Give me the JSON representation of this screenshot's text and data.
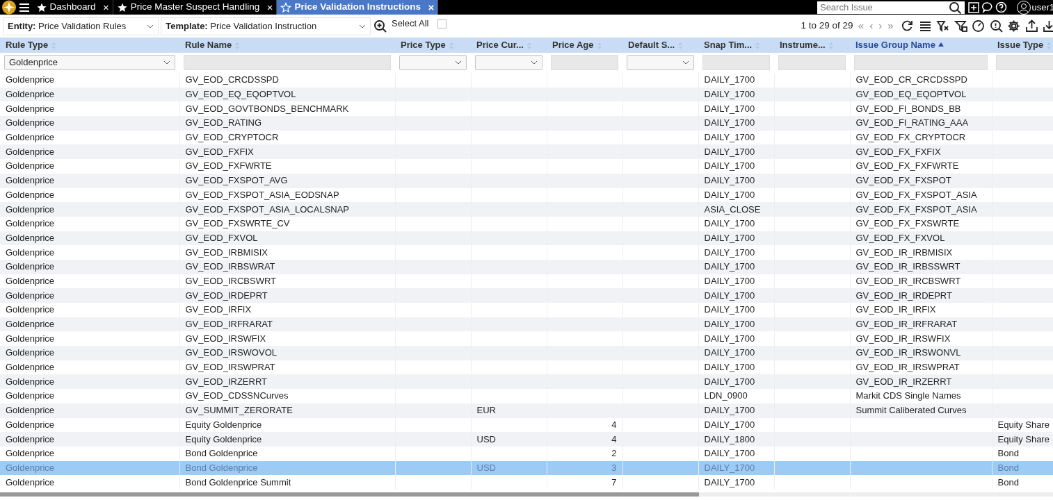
{
  "top_bar": {
    "tabs": [
      {
        "label": "Dashboard",
        "close": "×",
        "selected": false
      },
      {
        "label": "Price Master Suspect Handling",
        "close": "×",
        "selected": false
      },
      {
        "label": "Price Validation Instructions",
        "close": "×",
        "selected": true
      }
    ],
    "search": {
      "placeholder": "Search Issue"
    },
    "user": "user1"
  },
  "toolbar": {
    "entity": {
      "label": "Entity:",
      "value": "Price Validation Rules"
    },
    "template": {
      "label": "Template:",
      "value": "Price Validation Instruction"
    },
    "select_all": {
      "label": "Select All",
      "checked": false
    },
    "paging": {
      "summary": "1 to 29 of 29",
      "buttons": [
        {
          "label": "«",
          "disabled": true
        },
        {
          "label": "‹",
          "disabled": true
        },
        {
          "label": "›",
          "disabled": true
        },
        {
          "label": "»",
          "disabled": true
        }
      ]
    }
  },
  "grid": {
    "columns": [
      {
        "label": "Rule Type",
        "dropdown_filter": true,
        "filter_value": "Goldenprice",
        "sorted_ascending": false
      },
      {
        "label": "Rule Name",
        "dropdown_filter": false,
        "sorted_ascending": false
      },
      {
        "label": "Price Type",
        "dropdown_filter": true,
        "sorted_ascending": false
      },
      {
        "label": "Price Cur...",
        "dropdown_filter": true,
        "sorted_ascending": false
      },
      {
        "label": "Price Age",
        "dropdown_filter": false,
        "sorted_ascending": false
      },
      {
        "label": "Default S...",
        "dropdown_filter": true,
        "sorted_ascending": false
      },
      {
        "label": "Snap Tim...",
        "dropdown_filter": false,
        "sorted_ascending": false
      },
      {
        "label": "Instrume...",
        "dropdown_filter": false,
        "sorted_ascending": false
      },
      {
        "label": "Issue Group Name",
        "dropdown_filter": false,
        "sorted_ascending": true
      },
      {
        "label": "Issue Type",
        "dropdown_filter": false,
        "sorted_ascending": false
      }
    ],
    "rows": [
      {
        "selected": false,
        "rule_type": "Goldenprice",
        "rule_name": "GV_EOD_CRCDSSPD",
        "snap_time": "DAILY_1700",
        "issue_group_name": "GV_EOD_CR_CRCDSSPD"
      },
      {
        "selected": false,
        "rule_type": "Goldenprice",
        "rule_name": "GV_EOD_EQ_EQOPTVOL",
        "snap_time": "DAILY_1700",
        "issue_group_name": "GV_EOD_EQ_EQOPTVOL"
      },
      {
        "selected": false,
        "rule_type": "Goldenprice",
        "rule_name": "GV_EOD_GOVTBONDS_BENCHMARK",
        "snap_time": "DAILY_1700",
        "issue_group_name": "GV_EOD_FI_BONDS_BB"
      },
      {
        "selected": false,
        "rule_type": "Goldenprice",
        "rule_name": "GV_EOD_RATING",
        "snap_time": "DAILY_1700",
        "issue_group_name": "GV_EOD_FI_RATING_AAA"
      },
      {
        "selected": false,
        "rule_type": "Goldenprice",
        "rule_name": "GV_EOD_CRYPTOCR",
        "snap_time": "DAILY_1700",
        "issue_group_name": "GV_EOD_FX_CRYPTOCR"
      },
      {
        "selected": false,
        "rule_type": "Goldenprice",
        "rule_name": "GV_EOD_FXFIX",
        "snap_time": "DAILY_1700",
        "issue_group_name": "GV_EOD_FX_FXFIX"
      },
      {
        "selected": false,
        "rule_type": "Goldenprice",
        "rule_name": "GV_EOD_FXFWRTE",
        "snap_time": "DAILY_1700",
        "issue_group_name": "GV_EOD_FX_FXFWRTE"
      },
      {
        "selected": false,
        "rule_type": "Goldenprice",
        "rule_name": "GV_EOD_FXSPOT_AVG",
        "snap_time": "DAILY_1700",
        "issue_group_name": "GV_EOD_FX_FXSPOT"
      },
      {
        "selected": false,
        "rule_type": "Goldenprice",
        "rule_name": "GV_EOD_FXSPOT_ASIA_EODSNAP",
        "snap_time": "DAILY_1700",
        "issue_group_name": "GV_EOD_FX_FXSPOT_ASIA"
      },
      {
        "selected": false,
        "rule_type": "Goldenprice",
        "rule_name": "GV_EOD_FXSPOT_ASIA_LOCALSNAP",
        "snap_time": "ASIA_CLOSE",
        "issue_group_name": "GV_EOD_FX_FXSPOT_ASIA"
      },
      {
        "selected": false,
        "rule_type": "Goldenprice",
        "rule_name": "GV_EOD_FXSWRTE_CV",
        "snap_time": "DAILY_1700",
        "issue_group_name": "GV_EOD_FX_FXSWRTE"
      },
      {
        "selected": false,
        "rule_type": "Goldenprice",
        "rule_name": "GV_EOD_FXVOL",
        "snap_time": "DAILY_1700",
        "issue_group_name": "GV_EOD_FX_FXVOL"
      },
      {
        "selected": false,
        "rule_type": "Goldenprice",
        "rule_name": "GV_EOD_IRBMISIX",
        "snap_time": "DAILY_1700",
        "issue_group_name": "GV_EOD_IR_IRBMISIX"
      },
      {
        "selected": false,
        "rule_type": "Goldenprice",
        "rule_name": "GV_EOD_IRBSWRAT",
        "snap_time": "DAILY_1700",
        "issue_group_name": "GV_EOD_IR_IRBSSWRT"
      },
      {
        "selected": false,
        "rule_type": "Goldenprice",
        "rule_name": "GV_EOD_IRCBSWRT",
        "snap_time": "DAILY_1700",
        "issue_group_name": "GV_EOD_IR_IRCBSWRT"
      },
      {
        "selected": false,
        "rule_type": "Goldenprice",
        "rule_name": "GV_EOD_IRDEPRT",
        "snap_time": "DAILY_1700",
        "issue_group_name": "GV_EOD_IR_IRDEPRT"
      },
      {
        "selected": false,
        "rule_type": "Goldenprice",
        "rule_name": "GV_EOD_IRFIX",
        "snap_time": "DAILY_1700",
        "issue_group_name": "GV_EOD_IR_IRFIX"
      },
      {
        "selected": false,
        "rule_type": "Goldenprice",
        "rule_name": "GV_EOD_IRFRARAT",
        "snap_time": "DAILY_1700",
        "issue_group_name": "GV_EOD_IR_IRFRARAT"
      },
      {
        "selected": false,
        "rule_type": "Goldenprice",
        "rule_name": "GV_EOD_IRSWFIX",
        "snap_time": "DAILY_1700",
        "issue_group_name": "GV_EOD_IR_IRSWFIX"
      },
      {
        "selected": false,
        "rule_type": "Goldenprice",
        "rule_name": "GV_EOD_IRSWOVOL",
        "snap_time": "DAILY_1700",
        "issue_group_name": "GV_EOD_IR_IRSWONVL"
      },
      {
        "selected": false,
        "rule_type": "Goldenprice",
        "rule_name": "GV_EOD_IRSWPRAT",
        "snap_time": "DAILY_1700",
        "issue_group_name": "GV_EOD_IR_IRSWPRAT"
      },
      {
        "selected": false,
        "rule_type": "Goldenprice",
        "rule_name": "GV_EOD_IRZERRT",
        "snap_time": "DAILY_1700",
        "issue_group_name": "GV_EOD_IR_IRZERRT"
      },
      {
        "selected": false,
        "rule_type": "Goldenprice",
        "rule_name": "GV_EOD_CDSSNCurves",
        "snap_time": "LDN_0900",
        "issue_group_name": "Markit CDS Single Names"
      },
      {
        "selected": false,
        "rule_type": "Goldenprice",
        "rule_name": "GV_SUMMIT_ZERORATE",
        "price_currency": "EUR",
        "snap_time": "DAILY_1700",
        "issue_group_name": "Summit Caliberated Curves"
      },
      {
        "selected": false,
        "rule_type": "Goldenprice",
        "rule_name": "Equity Goldenprice",
        "price_age": "4",
        "snap_time": "DAILY_1700",
        "issue_type": "Equity Share"
      },
      {
        "selected": false,
        "rule_type": "Goldenprice",
        "rule_name": "Equity Goldenprice",
        "price_currency": "USD",
        "price_age": "4",
        "snap_time": "DAILY_1800",
        "issue_type": "Equity Share"
      },
      {
        "selected": false,
        "rule_type": "Goldenprice",
        "rule_name": "Bond Goldenprice",
        "price_age": "2",
        "snap_time": "DAILY_1700",
        "issue_type": "Bond"
      },
      {
        "selected": true,
        "rule_type": "Goldenprice",
        "rule_name": "Bond Goldenprice",
        "price_currency": "USD",
        "price_age": "3",
        "snap_time": "DAILY_1700",
        "issue_type": "Bond"
      },
      {
        "selected": false,
        "rule_type": "Goldenprice",
        "rule_name": "Bond Goldenprice Summit",
        "price_age": "7",
        "snap_time": "DAILY_1700",
        "issue_type": "Bond"
      }
    ]
  }
}
